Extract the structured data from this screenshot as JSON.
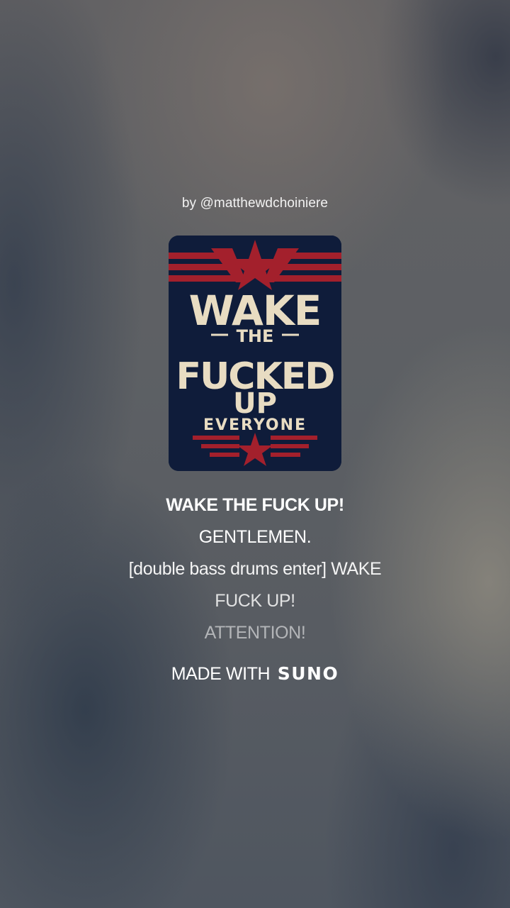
{
  "byline": "by @matthewdchoiniere",
  "cover_art": {
    "line1": "WAKE",
    "line2": "THE",
    "line3": "FUCKED",
    "line4": "UP",
    "line5": "EVERYONE",
    "colors": {
      "navy": "#0f1c3a",
      "red": "#a3202c",
      "cream": "#e8dcc2"
    }
  },
  "lyrics": [
    "WAKE THE FUCK UP!",
    "GENTLEMEN.",
    "[double bass drums enter] WAKE",
    "FUCK UP!",
    "ATTENTION!"
  ],
  "footer": {
    "prefix": "MADE WITH",
    "brand": "SUNO"
  }
}
